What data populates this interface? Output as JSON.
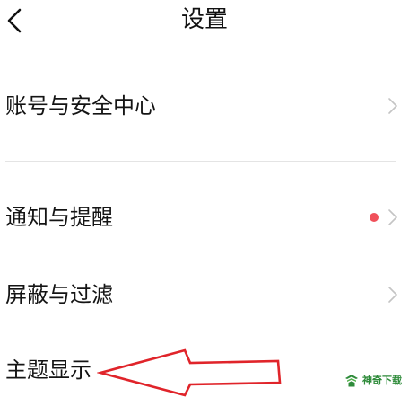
{
  "header": {
    "title": "设置",
    "back_icon": "chevron-left-icon"
  },
  "settings": {
    "items": [
      {
        "label": "账号与安全中心",
        "icon": "chevron-right-icon",
        "badge": null
      },
      {
        "label": "通知与提醒",
        "icon": "chevron-right-icon",
        "badge": "red-dot"
      },
      {
        "label": "屏蔽与过滤",
        "icon": "chevron-right-icon",
        "badge": null
      },
      {
        "label": "主题显示",
        "icon": null,
        "badge": null
      }
    ]
  },
  "annotation": {
    "arrow_color": "#e0242a",
    "points_to": "主题显示"
  },
  "watermark": {
    "text": "神奇下载",
    "color": "#2e8b3a"
  },
  "colors": {
    "badge_red": "#f0505a",
    "chevron_gray": "#c4c4c4",
    "divider": "#e4e4e4",
    "text": "#141414"
  }
}
